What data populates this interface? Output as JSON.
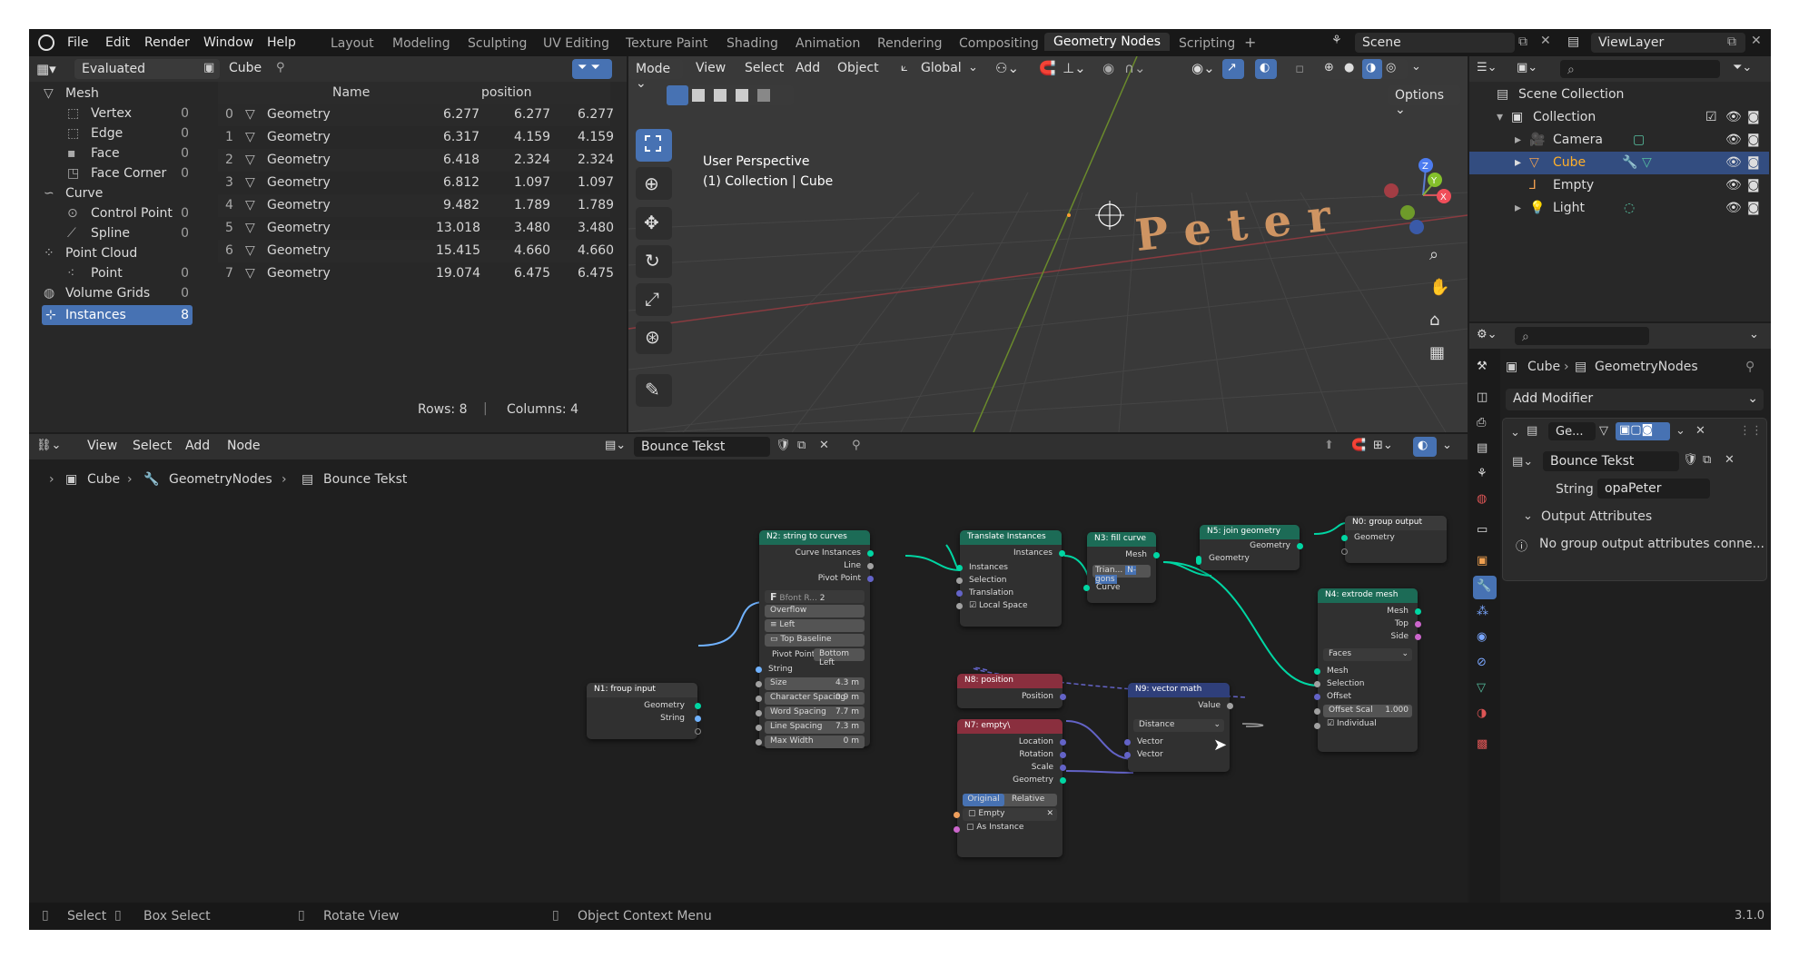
{
  "menus": [
    "File",
    "Edit",
    "Render",
    "Window",
    "Help"
  ],
  "workspaces": [
    "Layout",
    "Modeling",
    "Sculpting",
    "UV Editing",
    "Texture Paint",
    "Shading",
    "Animation",
    "Rendering",
    "Compositing",
    "Geometry Nodes",
    "Scripting"
  ],
  "active_workspace": "Geometry Nodes",
  "scene": "Scene",
  "view_layer": "ViewLayer",
  "spreadsheet": {
    "mode": "Evaluated",
    "object": "Cube",
    "col_name": "Name",
    "col_position": "position",
    "side": {
      "mesh": "Mesh",
      "vertex": "Vertex",
      "vertex_count": "0",
      "edge": "Edge",
      "edge_count": "0",
      "face": "Face",
      "face_count": "0",
      "face_corner": "Face Corner",
      "face_corner_count": "0",
      "curve": "Curve",
      "control_point": "Control Point",
      "control_point_count": "0",
      "spline": "Spline",
      "spline_count": "0",
      "point_cloud": "Point Cloud",
      "point": "Point",
      "point_count": "0",
      "volume_grids": "Volume Grids",
      "volume_grids_count": "0",
      "instances": "Instances",
      "instances_count": "8"
    },
    "rows": [
      {
        "idx": "0",
        "name": "Geometry",
        "x": "6.277",
        "y": "6.277",
        "z": "6.277"
      },
      {
        "idx": "1",
        "name": "Geometry",
        "x": "6.317",
        "y": "4.159",
        "z": "4.159"
      },
      {
        "idx": "2",
        "name": "Geometry",
        "x": "6.418",
        "y": "2.324",
        "z": "2.324"
      },
      {
        "idx": "3",
        "name": "Geometry",
        "x": "6.812",
        "y": "1.097",
        "z": "1.097"
      },
      {
        "idx": "4",
        "name": "Geometry",
        "x": "9.482",
        "y": "1.789",
        "z": "1.789"
      },
      {
        "idx": "5",
        "name": "Geometry",
        "x": "13.018",
        "y": "3.480",
        "z": "3.480"
      },
      {
        "idx": "6",
        "name": "Geometry",
        "x": "15.415",
        "y": "4.660",
        "z": "4.660"
      },
      {
        "idx": "7",
        "name": "Geometry",
        "x": "19.074",
        "y": "6.475",
        "z": "6.475"
      }
    ],
    "rows_label": "Rows: 8",
    "cols_label": "Columns: 4"
  },
  "viewport": {
    "mode": "Mode",
    "view": "View",
    "select": "Select",
    "add": "Add",
    "object": "Object",
    "transform": "Global",
    "options": "Options",
    "title": "User Perspective",
    "subtitle": "(1) Collection | Cube",
    "text3d": "Peter"
  },
  "outliner": {
    "scene_collection": "Scene Collection",
    "collection": "Collection",
    "camera": "Camera",
    "cube": "Cube",
    "empty": "Empty",
    "light": "Light"
  },
  "properties": {
    "breadcrumb_obj": "Cube",
    "breadcrumb_mod": "GeometryNodes",
    "add_modifier": "Add Modifier",
    "modifier_name": "Ge...",
    "tree": "Bounce Tekst",
    "string_label": "String",
    "string_value": "opaPeter",
    "output_attrs": "Output Attributes",
    "warning": "No group output attributes conne..."
  },
  "node_editor": {
    "view": "View",
    "select": "Select",
    "add": "Add",
    "node": "Node",
    "tree": "Bounce Tekst",
    "bc_obj": "Cube",
    "bc_mod": "GeometryNodes",
    "bc_tree": "Bounce Tekst",
    "n1": {
      "title": "N1: froup input",
      "geometry": "Geometry",
      "string": "String"
    },
    "n2": {
      "title": "N2: string to curves",
      "curve_instances": "Curve Instances",
      "line": "Line",
      "pivot_point_out": "Pivot Point",
      "font": "Bfont R...",
      "font_users": "2",
      "overflow": "Overflow",
      "align_x": "Left",
      "align_y": "Top Baseline",
      "pivot_label": "Pivot Point",
      "pivot_value": "Bottom Left",
      "string": "String",
      "size": "Size",
      "size_v": "4.3 m",
      "char_spacing": "Character Spacing",
      "char_spacing_v": "0.9 m",
      "word_spacing": "Word Spacing",
      "word_spacing_v": "7.7 m",
      "line_spacing": "Line Spacing",
      "line_spacing_v": "7.3 m",
      "max_width": "Max Width",
      "max_width_v": "0 m"
    },
    "translate": {
      "title": "Translate Instances",
      "instances_out": "Instances",
      "instances": "Instances",
      "selection": "Selection",
      "translation": "Translation",
      "local_space": "Local Space"
    },
    "n3": {
      "title": "N3: fill curve",
      "mesh": "Mesh",
      "mode_a": "Trian...",
      "mode_b": "N-gons",
      "curve": "Curve"
    },
    "n5": {
      "title": "N5: join geometry",
      "geometry_out": "Geometry",
      "geometry": "Geometry"
    },
    "n0": {
      "title": "N0: group output",
      "geometry": "Geometry"
    },
    "n4": {
      "title": "N4: extrode mesh",
      "mesh_out": "Mesh",
      "top": "Top",
      "side": "Side",
      "mode": "Faces",
      "mesh": "Mesh",
      "selection": "Selection",
      "offset": "Offset",
      "offset_scale": "Offset Scal",
      "offset_scale_v": "1.000",
      "individual": "Individual"
    },
    "n8": {
      "title": "N8: position",
      "position": "Position"
    },
    "n9": {
      "title": "N9: vector math",
      "value": "Value",
      "op": "Distance",
      "vector_a": "Vector",
      "vector_b": "Vector"
    },
    "n7": {
      "title": "N7: empty\\",
      "location": "Location",
      "rotation": "Rotation",
      "scale": "Scale",
      "geometry": "Geometry",
      "original": "Original",
      "relative": "Relative",
      "object": "Empty",
      "as_instance": "As Instance"
    }
  },
  "status": {
    "select": "Select",
    "box_select": "Box Select",
    "rotate_view": "Rotate View",
    "context_menu": "Object Context Menu",
    "version": "3.1.0"
  },
  "colors": {
    "geometry_socket": "#00d6a3",
    "string_socket": "#70b2ff",
    "vector_socket": "#6363c7",
    "geometry_header": "#1c6b56",
    "input_header": "#8a2f3e",
    "vector_header": "#2f3f7a",
    "accent": "#4772b3"
  }
}
